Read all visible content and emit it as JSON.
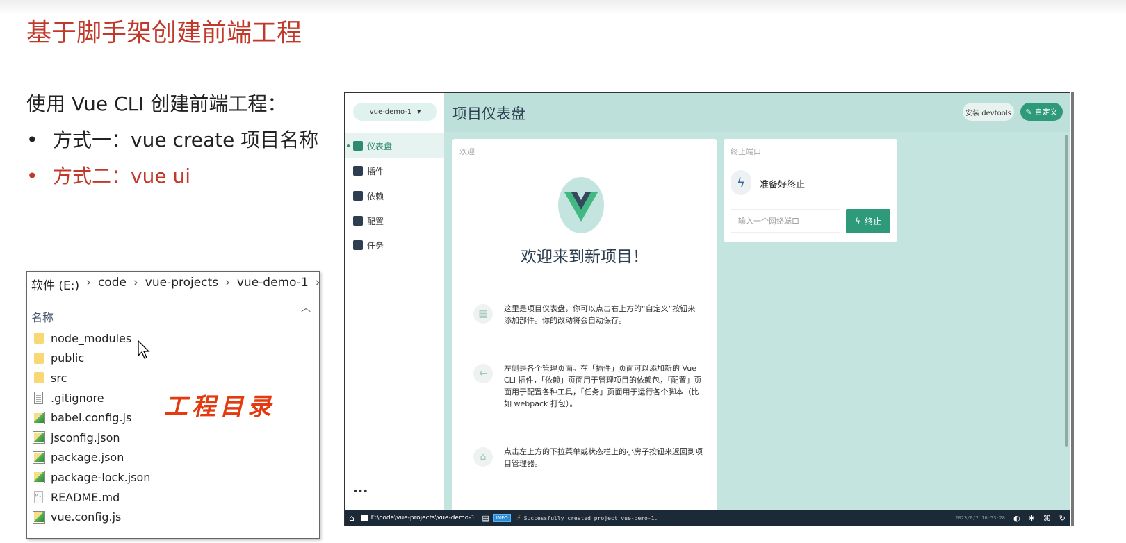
{
  "slide": {
    "title": "基于脚手架创建前端工程",
    "subtitle": "使用 Vue CLI 创建前端工程：",
    "bullets": [
      {
        "dot": "•",
        "text": "方式一：vue create 项目名称"
      },
      {
        "dot": "•",
        "text": "方式二：vue ui"
      }
    ],
    "annotation": "工程目录",
    "title_color": "#c0392b"
  },
  "explorer": {
    "breadcrumbs": [
      "软件 (E:)",
      "code",
      "vue-projects",
      "vue-demo-1"
    ],
    "separator": "›",
    "column_header": "名称",
    "files": [
      {
        "name": "node_modules",
        "icon": "folder"
      },
      {
        "name": "public",
        "icon": "folder"
      },
      {
        "name": "src",
        "icon": "folder"
      },
      {
        "name": ".gitignore",
        "icon": "text-file"
      },
      {
        "name": "babel.config.js",
        "icon": "script-file"
      },
      {
        "name": "jsconfig.json",
        "icon": "script-file"
      },
      {
        "name": "package.json",
        "icon": "script-file"
      },
      {
        "name": "package-lock.json",
        "icon": "script-file"
      },
      {
        "name": "README.md",
        "icon": "markdown-file"
      },
      {
        "name": "vue.config.js",
        "icon": "script-file"
      }
    ]
  },
  "vue_ui": {
    "project_select": "vue-demo-1",
    "nav": [
      {
        "label": "仪表盘",
        "active": true
      },
      {
        "label": "插件",
        "active": false
      },
      {
        "label": "依赖",
        "active": false
      },
      {
        "label": "配置",
        "active": false
      },
      {
        "label": "任务",
        "active": false
      }
    ],
    "more": "•••",
    "page_title": "项目仪表盘",
    "devtools_button": "安装 devtools",
    "custom_button": "自定义",
    "welcome": {
      "label": "欢迎",
      "title": "欢迎来到新项目！",
      "tips": [
        "这里是项目仪表盘，你可以点击右上方的“自定义”按钮来添加部件。你的改动将会自动保存。",
        "左侧是各个管理页面。在「插件」页面可以添加新的 Vue CLI 插件，「依赖」页面用于管理项目的依赖包，「配置」页面用于配置各种工具，「任务」页面用于运行各个脚本（比如 webpack 打包）。",
        "点击左上方的下拉菜单或状态栏上的小房子按钮来返回到项目管理器。"
      ]
    },
    "port": {
      "label": "终止端口",
      "status": "准备好终止",
      "input_placeholder": "输入一个网络端口",
      "stop_button": "终止"
    },
    "statusbar": {
      "path": "E:\\code\\vue-projects\\vue-demo-1",
      "badge": "INFO",
      "message": "Successfully created project vue-demo-1.",
      "time": "2023/8/2 16:53:28"
    },
    "accent_color": "#2e9a7a"
  }
}
